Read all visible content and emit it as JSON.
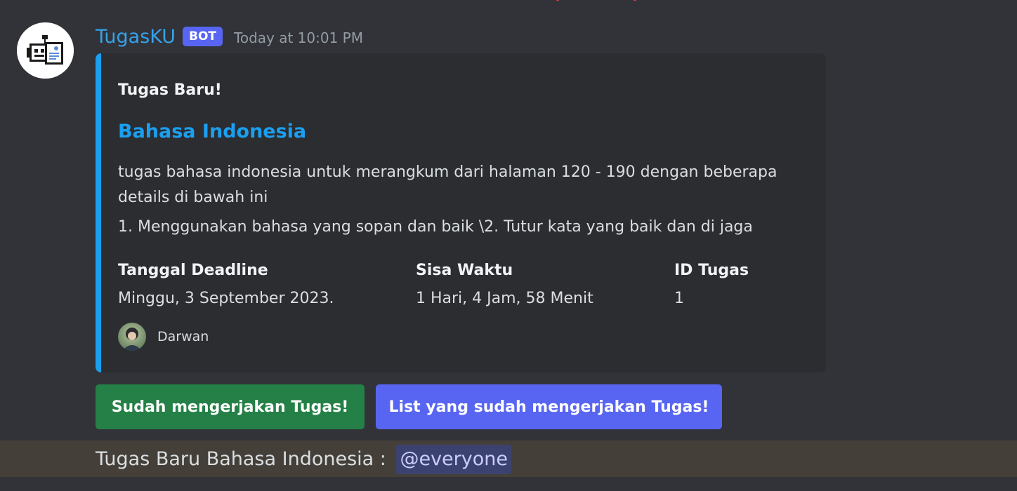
{
  "message": {
    "author": "TugasKU",
    "bot_tag": "BOT",
    "timestamp": "Today at 10:01 PM",
    "avatar_icon": "robot-document-icon"
  },
  "embed": {
    "accent_color": "#1b9ff0",
    "author": "Tugas Baru!",
    "title": "Bahasa Indonesia",
    "description": "tugas bahasa indonesia untuk merangkum dari halaman 120 - 190 dengan beberapa details di bawah ini",
    "description_item": "1. Menggunakan bahasa yang sopan dan baik \\2. Tutur kata yang baik dan di jaga",
    "fields": [
      {
        "name": "Tanggal Deadline",
        "value": "Minggu, 3 September 2023."
      },
      {
        "name": "Sisa Waktu",
        "value": "1 Hari, 4 Jam, 58 Menit"
      },
      {
        "name": "ID Tugas",
        "value": "1"
      }
    ],
    "footer": {
      "text": "Darwan",
      "icon": "user-avatar"
    }
  },
  "buttons": {
    "done_label": "Sudah mengerjakan Tugas!",
    "done_color": "#248046",
    "list_label": "List yang sudah mengerjakan Tugas!",
    "list_color": "#5865f2"
  },
  "mention_message": {
    "text": "Tugas Baru Bahasa Indonesia :",
    "mention": "@everyone"
  }
}
